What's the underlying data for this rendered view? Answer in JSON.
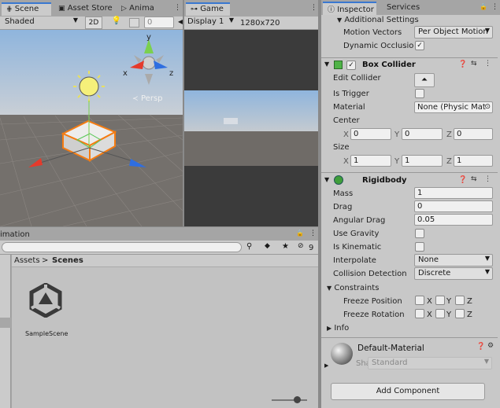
{
  "scene_panel": {
    "tabs": [
      {
        "label": "Scene"
      },
      {
        "label": "Asset Store"
      },
      {
        "label": "Anima"
      }
    ],
    "shading_mode": "Shaded",
    "mode_2d": "2D",
    "count": "0",
    "gizmo": {
      "y": "y",
      "x": "x",
      "z": "z",
      "persp": "Persp"
    }
  },
  "game_panel": {
    "tab": "Game",
    "display": "Display 1",
    "resolution": "1280x720"
  },
  "project_panel": {
    "tab": "imation",
    "breadcrumb": {
      "root": "Assets",
      "current": "Scenes"
    },
    "hidden_count": "9",
    "asset": {
      "name": "SampleScene"
    }
  },
  "inspector": {
    "tabs": [
      {
        "label": "Inspector"
      },
      {
        "label": "Services"
      }
    ],
    "additional_settings": "Additional Settings",
    "motion_vectors": {
      "label": "Motion Vectors",
      "value": "Per Object Motion"
    },
    "dynamic_occlusion": {
      "label": "Dynamic Occlusio",
      "checked": "✓"
    },
    "box_collider": {
      "title": "Box Collider",
      "edit_collider": "Edit Collider",
      "is_trigger": "Is Trigger",
      "material_label": "Material",
      "material_value": "None (Physic Mat",
      "center_label": "Center",
      "center": {
        "x": "0",
        "y": "0",
        "z": "0"
      },
      "size_label": "Size",
      "size": {
        "x": "1",
        "y": "1",
        "z": "1"
      },
      "axes": {
        "x": "X",
        "y": "Y",
        "z": "Z"
      }
    },
    "rigidbody": {
      "title": "Rigidbody",
      "mass": {
        "label": "Mass",
        "value": "1"
      },
      "drag": {
        "label": "Drag",
        "value": "0"
      },
      "angular_drag": {
        "label": "Angular Drag",
        "value": "0.05"
      },
      "use_gravity": "Use Gravity",
      "is_kinematic": "Is Kinematic",
      "interpolate": {
        "label": "Interpolate",
        "value": "None"
      },
      "collision_detection": {
        "label": "Collision Detection",
        "value": "Discrete"
      },
      "constraints": "Constraints",
      "freeze_position": "Freeze Position",
      "freeze_rotation": "Freeze Rotation",
      "info": "Info"
    },
    "material": {
      "name": "Default-Material",
      "shader_label": "Shader",
      "shader_value": "Standard"
    },
    "add_component": "Add Component"
  }
}
